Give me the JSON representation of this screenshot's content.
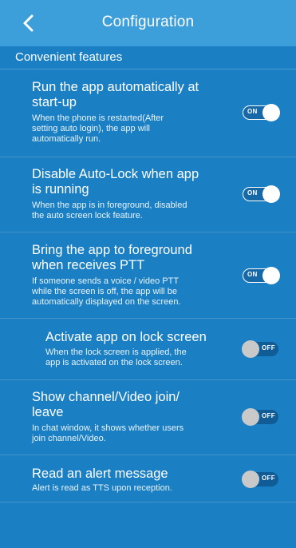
{
  "header": {
    "title": "Configuration",
    "back_icon": "chevron-left-icon"
  },
  "section": {
    "title": "Convenient features"
  },
  "settings": [
    {
      "title_lines": [
        "Run the app automatically at",
        "start-up"
      ],
      "desc_lines": [
        "When the phone is restarted(After",
        "setting auto login), the app will",
        "automatically run."
      ],
      "state": "ON"
    },
    {
      "title_lines": [
        "Disable Auto-Lock when app",
        "is running"
      ],
      "desc_lines": [
        "When the app is in foreground, disabled",
        "the auto screen lock feature."
      ],
      "state": "ON"
    },
    {
      "title_lines": [
        "Bring the app to foreground",
        "when receives PTT"
      ],
      "desc_lines": [
        "If someone sends a voice / video PTT",
        "while the screen is off, the app will be",
        "automatically displayed on the screen."
      ],
      "state": "ON"
    },
    {
      "title_lines": [
        "Activate app on lock screen"
      ],
      "desc_lines": [
        "When the lock screen is applied, the",
        "app is activated on the lock screen."
      ],
      "state": "OFF"
    },
    {
      "title_lines": [
        "Show channel/Video join/",
        "leave"
      ],
      "desc_lines": [
        "In chat window, it shows whether users",
        "join channel/Video."
      ],
      "state": "OFF"
    },
    {
      "title_lines": [
        "Read an alert message"
      ],
      "desc_lines": [
        "Alert is read as TTS upon reception."
      ],
      "state": "OFF"
    }
  ]
}
